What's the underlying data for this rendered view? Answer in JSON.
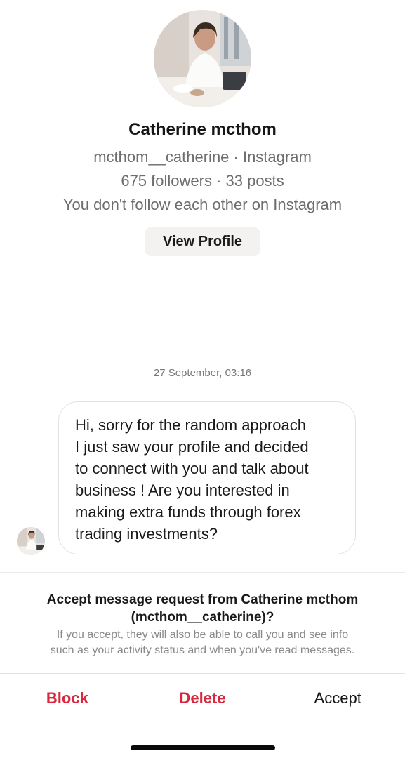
{
  "profile": {
    "name": "Catherine mcthom",
    "handle_line": "mcthom__catherine · Instagram",
    "stats_line": "675 followers · 33 posts",
    "follow_status": "You don't follow each other on Instagram",
    "view_profile_label": "View Profile"
  },
  "conversation": {
    "timestamp": "27 September, 03:16",
    "message_lines": [
      "Hi, sorry  for the random approach",
      "I just saw your profile and decided",
      "to connect with you and talk about",
      "business ! Are you interested in",
      "making extra funds through forex",
      "trading investments?"
    ]
  },
  "request": {
    "title_line1": "Accept message request from Catherine mcthom",
    "title_line2": "(mcthom__catherine)?",
    "desc_line1": "If you accept, they will also be able to call you and see info",
    "desc_line2": "such as your activity status and when you've read messages."
  },
  "actions": {
    "block_label": "Block",
    "delete_label": "Delete",
    "accept_label": "Accept"
  },
  "colors": {
    "destructive": "#d8283d",
    "secondary_text": "#6d6d6d",
    "button_bg": "#f3f2f0"
  }
}
